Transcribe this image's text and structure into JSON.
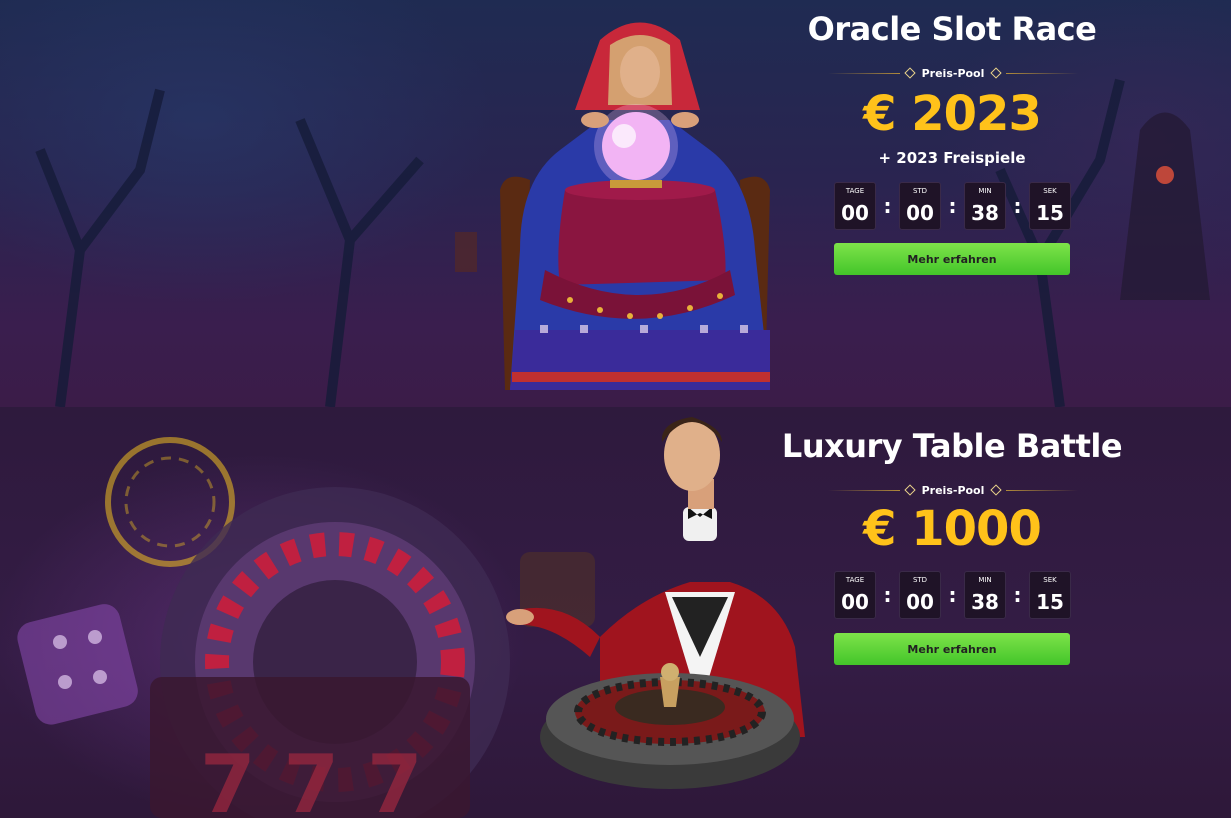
{
  "promotions": [
    {
      "title": "Oracle Slot Race",
      "pool_label": "Preis-Pool",
      "prize": "€ 2023",
      "extra": "+ 2023 Freispiele",
      "countdown": [
        {
          "unit": "TAGE",
          "value": "00"
        },
        {
          "unit": "STD",
          "value": "00"
        },
        {
          "unit": "MIN",
          "value": "38"
        },
        {
          "unit": "SEK",
          "value": "15"
        }
      ],
      "button_label": "Mehr erfahren"
    },
    {
      "title": "Luxury Table Battle",
      "pool_label": "Preis-Pool",
      "prize": "€ 1000",
      "countdown": [
        {
          "unit": "TAGE",
          "value": "00"
        },
        {
          "unit": "STD",
          "value": "00"
        },
        {
          "unit": "MIN",
          "value": "38"
        },
        {
          "unit": "SEK",
          "value": "15"
        }
      ],
      "button_label": "Mehr erfahren"
    }
  ],
  "countdown_separator": ":",
  "colors": {
    "prize": "#ffc21a",
    "button": "#4ccb2e",
    "background": "#2a1638"
  },
  "illustrations": {
    "banner_1": "fortune-teller-illustration",
    "banner_2": "croupier-roulette-illustration"
  }
}
